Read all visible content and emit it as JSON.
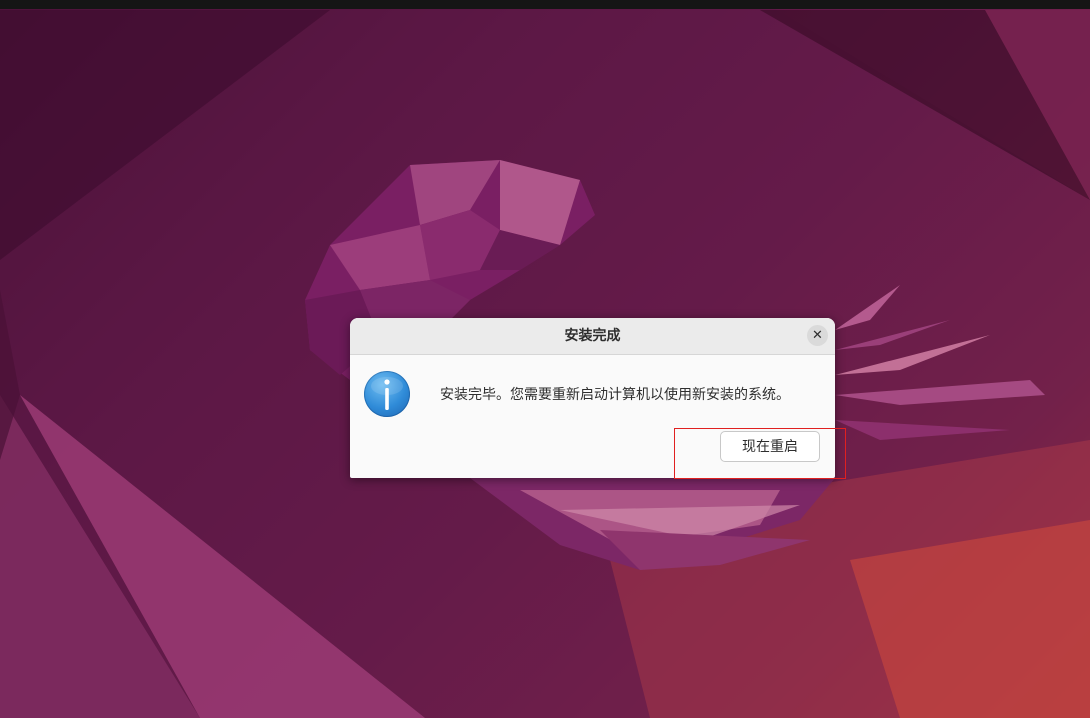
{
  "dialog": {
    "title": "安装完成",
    "close_symbol": "✕",
    "icon": "info-icon",
    "message": "安装完毕。您需要重新启动计算机以使用新安装的系统。",
    "restart_label": "现在重启"
  },
  "colors": {
    "highlight": "#e02020",
    "dialog_background": "#fafafa",
    "titlebar_background": "#ebebeb",
    "info_icon_blue": "#2f8bd8"
  }
}
